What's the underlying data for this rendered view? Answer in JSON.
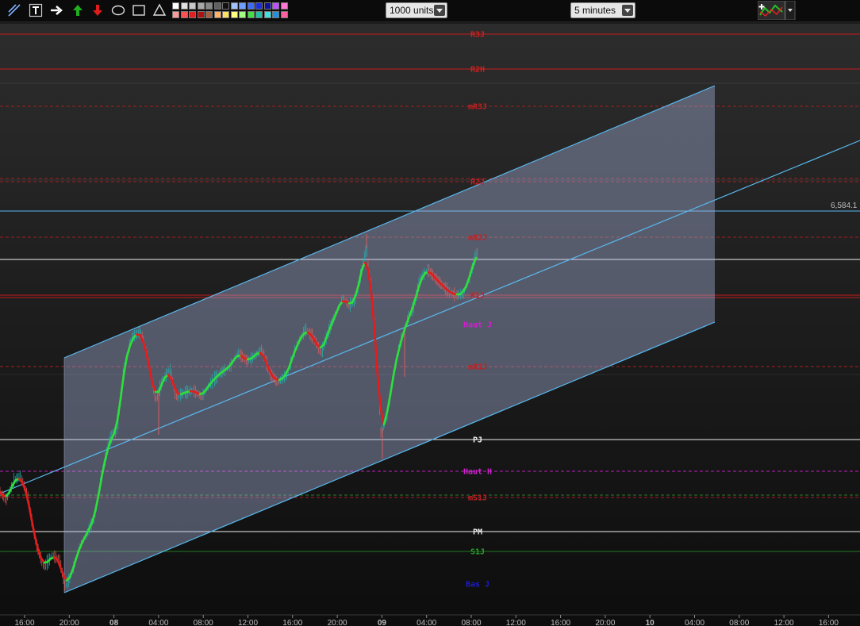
{
  "toolbar": {
    "tools": [
      {
        "name": "trendline-tool-icon"
      },
      {
        "name": "text-tool-icon"
      },
      {
        "name": "arrow-right-tool-icon"
      },
      {
        "name": "arrow-up-tool-icon"
      },
      {
        "name": "arrow-down-tool-icon"
      },
      {
        "name": "ellipse-tool-icon"
      },
      {
        "name": "rectangle-tool-icon"
      },
      {
        "name": "triangle-tool-icon"
      }
    ],
    "palette": [
      [
        "#ffffff",
        "#e0e0e0",
        "#c8c8c8",
        "#a8a8a8",
        "#888888",
        "#606060",
        "#101010",
        "#9ec3ff",
        "#6f9fff",
        "#3a6bff",
        "#1a2ee0",
        "#1010a0",
        "#c050ff",
        "#ff7ad0"
      ],
      [
        "#ff9a9a",
        "#ff5050",
        "#e02020",
        "#b01010",
        "#a06040",
        "#ffb060",
        "#ffe060",
        "#ffff80",
        "#a0ff80",
        "#40e040",
        "#20c0a0",
        "#40e0e0",
        "#2090e0",
        "#ff60a0"
      ]
    ],
    "units": "1000 units",
    "timeframe": "5 minutes",
    "indicator_icon": "indicator-menu-icon"
  },
  "colors": {
    "red": "#d41e1e",
    "dark_red": "#b02020",
    "magenta": "#d020d0",
    "green": "#2aa02a",
    "blue": "#1c1ccc",
    "white": "#f0f0f0",
    "cyan": "#58b8ee"
  },
  "levels": [
    {
      "label": "R3J",
      "style": "solid",
      "color": "#c41c1c",
      "label_color": "#d41e1e"
    },
    {
      "label": "R2H",
      "style": "solid",
      "color": "#c41c1c",
      "label_color": "#d41e1e"
    },
    {
      "label": "mR3J",
      "style": "dashed",
      "color": "#a52020",
      "label_color": "#c42020"
    },
    {
      "label": "R2J",
      "style": "dashed",
      "color": "#a52020",
      "label_color": "#c42020"
    },
    {
      "label": "mR2J",
      "style": "dashed",
      "color": "#a52020",
      "label_color": "#c42020"
    },
    {
      "label": "R1J",
      "style": "solid",
      "color": "#c41c1c",
      "label_color": "#d41e1e"
    },
    {
      "label": "Haut J",
      "style": "none",
      "color": "#d020d0",
      "label_color": "#d020d0"
    },
    {
      "label": "mR1J",
      "style": "dashed",
      "color": "#a52020",
      "label_color": "#c42020"
    },
    {
      "label": "PJ",
      "style": "solid",
      "color": "#f0f0f0",
      "label_color": "#f0f0f0"
    },
    {
      "label": "Haut H",
      "style": "dashed",
      "color": "#c020c0",
      "label_color": "#d020d0"
    },
    {
      "label": "mS1J",
      "style": "dashed",
      "color": "#a52020",
      "label_color": "#c42020"
    },
    {
      "label": "PM",
      "style": "solid",
      "color": "#f0f0f0",
      "label_color": "#f0f0f0"
    },
    {
      "label": "S1J",
      "style": "solid",
      "color": "#1e7a1e",
      "label_color": "#2aa02a"
    },
    {
      "label": "Bas J",
      "style": "none",
      "color": "#1c1ccc",
      "label_color": "#1c1ccc"
    }
  ],
  "price_label": "6,584.1",
  "time_axis": [
    {
      "label": "16:00",
      "bold": false
    },
    {
      "label": "20:00",
      "bold": false
    },
    {
      "label": "08",
      "bold": true
    },
    {
      "label": "04:00",
      "bold": false
    },
    {
      "label": "08:00",
      "bold": false
    },
    {
      "label": "12:00",
      "bold": false
    },
    {
      "label": "16:00",
      "bold": false
    },
    {
      "label": "20:00",
      "bold": false
    },
    {
      "label": "09",
      "bold": true
    },
    {
      "label": "04:00",
      "bold": false
    },
    {
      "label": "08:00",
      "bold": false
    },
    {
      "label": "12:00",
      "bold": false
    },
    {
      "label": "16:00",
      "bold": false
    },
    {
      "label": "20:00",
      "bold": false
    },
    {
      "label": "10",
      "bold": true
    },
    {
      "label": "04:00",
      "bold": false
    },
    {
      "label": "08:00",
      "bold": false
    },
    {
      "label": "12:00",
      "bold": false
    },
    {
      "label": "16:00",
      "bold": false
    }
  ]
}
